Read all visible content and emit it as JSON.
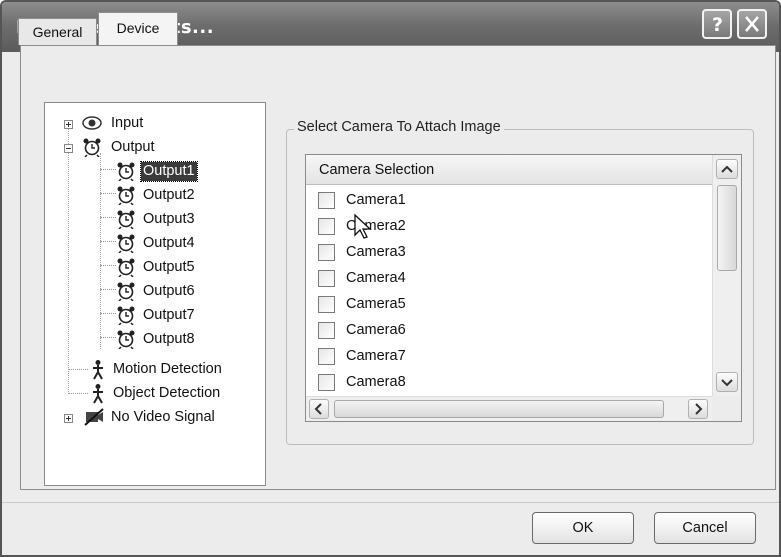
{
  "window": {
    "title": "Reported Events..."
  },
  "tabs": [
    {
      "label": "General"
    },
    {
      "label": "Device"
    }
  ],
  "tree": {
    "input": "Input",
    "output": "Output",
    "outputs": [
      "Output1",
      "Output2",
      "Output3",
      "Output4",
      "Output5",
      "Output6",
      "Output7",
      "Output8"
    ],
    "motion": "Motion Detection",
    "object": "Object Detection",
    "novideo": "No Video Signal"
  },
  "camera_group": {
    "title": "Select Camera To Attach Image",
    "column_header": "Camera Selection",
    "cameras": [
      "Camera1",
      "Camera2",
      "Camera3",
      "Camera4",
      "Camera5",
      "Camera6",
      "Camera7",
      "Camera8"
    ]
  },
  "buttons": {
    "ok": "OK",
    "cancel": "Cancel"
  },
  "icons": [
    "help-icon",
    "close-icon",
    "input-eye-icon",
    "alarm-clock-icon",
    "motion-person-icon",
    "no-video-camera-icon"
  ]
}
